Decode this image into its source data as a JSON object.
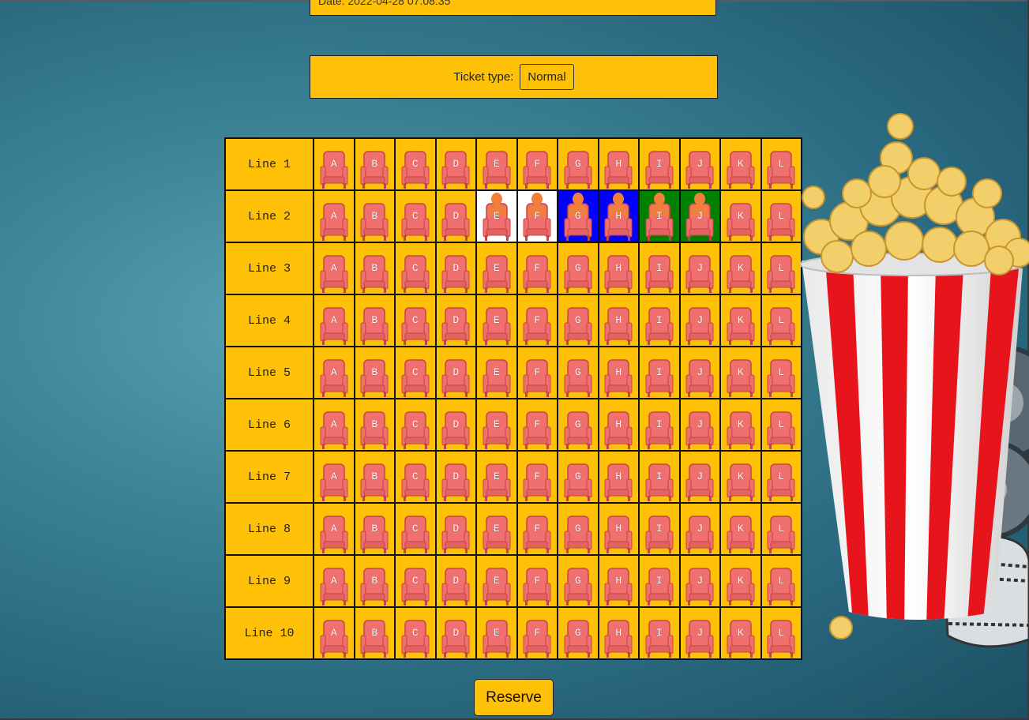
{
  "header": {
    "date_label": "Date: 2022-04-28 07:08:35"
  },
  "ticket": {
    "label": "Ticket type:",
    "selected": "Normal"
  },
  "columns": [
    "A",
    "B",
    "C",
    "D",
    "E",
    "F",
    "G",
    "H",
    "I",
    "J",
    "K",
    "L"
  ],
  "lines": [
    "Line 1",
    "Line 2",
    "Line 3",
    "Line 4",
    "Line 5",
    "Line 6",
    "Line 7",
    "Line 8",
    "Line 9",
    "Line 10"
  ],
  "occupied": {
    "Line 2": {
      "E": "white",
      "F": "white",
      "G": "blue",
      "H": "blue",
      "I": "green",
      "J": "green"
    }
  },
  "colors": {
    "background": "#3f8799",
    "panel": "#ffc107",
    "seat": "#f07070",
    "person": "#f07f3a",
    "white": "#ffffff",
    "blue": "#0000ff",
    "green": "#008000"
  },
  "icons": {
    "seat": "cinema-seat-icon",
    "person": "person-head-icon",
    "decoration": "popcorn-bucket-icon"
  },
  "actions": {
    "reserve_label": "Reserve"
  }
}
